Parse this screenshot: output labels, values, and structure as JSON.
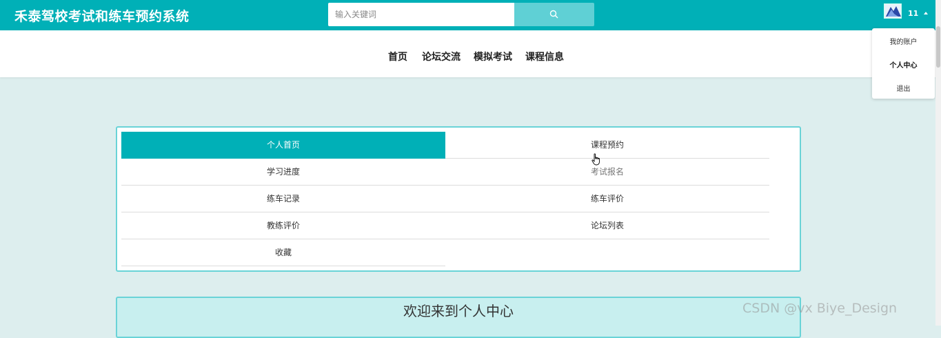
{
  "header": {
    "site_title": "禾泰驾校考试和练车预约系统",
    "search_placeholder": "输入关键词",
    "username": "11"
  },
  "nav": {
    "items": [
      "首页",
      "论坛交流",
      "模拟考试",
      "课程信息"
    ]
  },
  "user_menu": {
    "items": [
      "我的账户",
      "个人中心",
      "退出"
    ],
    "active_item": "个人中心"
  },
  "center_menu": {
    "tiles": [
      {
        "label": "个人首页",
        "active": true
      },
      {
        "label": "课程预约",
        "active": false
      },
      {
        "label": "学习进度",
        "active": false
      },
      {
        "label": "考试报名",
        "active": false
      },
      {
        "label": "练车记录",
        "active": false
      },
      {
        "label": "练车评价",
        "active": false
      },
      {
        "label": "教练评价",
        "active": false
      },
      {
        "label": "论坛列表",
        "active": false
      },
      {
        "label": "收藏",
        "active": false
      }
    ]
  },
  "welcome": {
    "title": "欢迎来到个人中心"
  },
  "watermark": "CSDN @vx  Biye_Design",
  "colors": {
    "primary": "#00b0b7",
    "search_button": "#5fd0d5",
    "page_background": "#ddeeee",
    "card_border": "#69d3d7"
  },
  "icons": {
    "search": "search-icon",
    "avatar": "avatar-image",
    "cursor": "hand-pointer-icon"
  }
}
